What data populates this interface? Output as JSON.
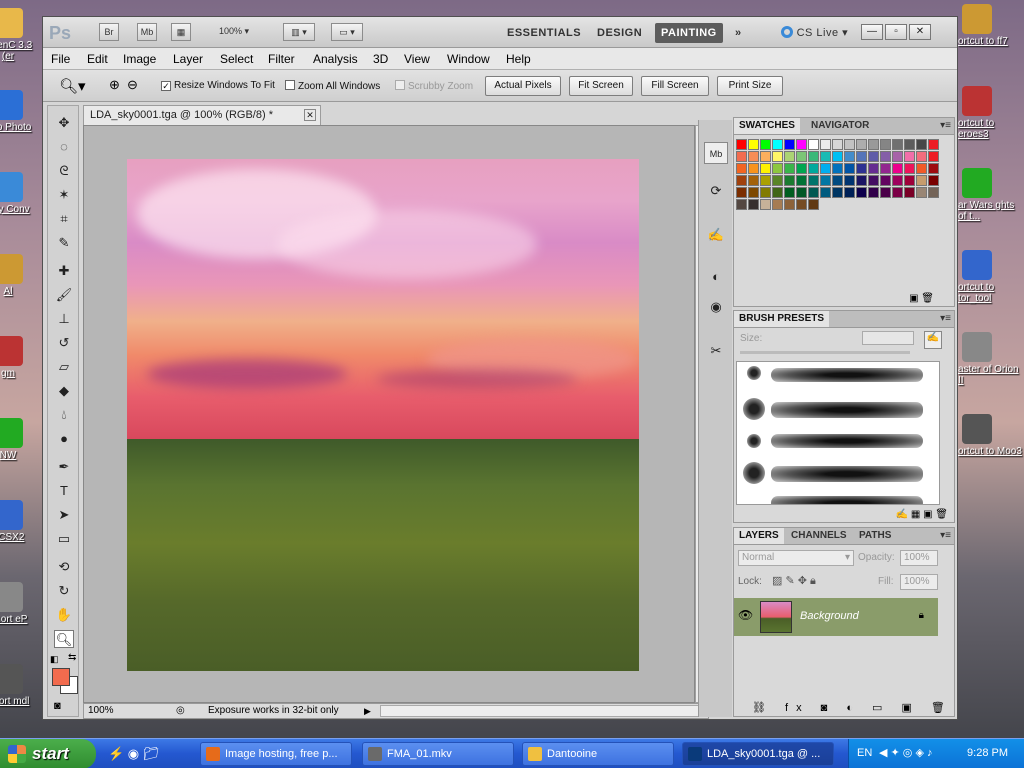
{
  "desktop": {
    "icons_left": [
      {
        "label": "OpenC 3.3 (er",
        "icon": "folder-icon"
      },
      {
        "label": "Ado Photo",
        "icon": "adobe-icon"
      },
      {
        "label": "Any Conv",
        "icon": "converter-icon"
      },
      {
        "label": "Al",
        "icon": "app-icon"
      },
      {
        "label": "gm",
        "icon": "gimp-icon"
      },
      {
        "label": "NW",
        "icon": "nwn-icon"
      },
      {
        "label": "PCSX2",
        "icon": "pcsx2-icon"
      },
      {
        "label": "Short eP",
        "icon": "shortcut-icon"
      },
      {
        "label": "Short mdl",
        "icon": "shortcut-icon"
      }
    ],
    "icons_right": [
      {
        "label": "ortcut to ff7",
        "icon": "ff7-icon"
      },
      {
        "label": "ortcut to eroes3",
        "icon": "heroes-icon"
      },
      {
        "label": "ar Wars ghts of t...",
        "icon": "starwars-icon"
      },
      {
        "label": "ortcut to tor_tool",
        "icon": "tool-icon"
      },
      {
        "label": "aster of Orion II",
        "icon": "orion-icon"
      },
      {
        "label": "ortcut to Moo3",
        "icon": "moo3-icon"
      }
    ]
  },
  "app": {
    "logo": "Ps",
    "bridge_btn": "Br",
    "minibridge_btn": "Mb",
    "zoom_level": "100%",
    "workspaces": [
      "ESSENTIALS",
      "DESIGN",
      "PAINTING"
    ],
    "active_workspace": "PAINTING",
    "more_label": "»",
    "cslive": "CS Live"
  },
  "menu": [
    "File",
    "Edit",
    "Image",
    "Layer",
    "Select",
    "Filter",
    "Analysis",
    "3D",
    "View",
    "Window",
    "Help"
  ],
  "options": {
    "resize_windows": "Resize Windows To Fit",
    "zoom_all": "Zoom All Windows",
    "scrubby": "Scrubby Zoom",
    "actual_pixels": "Actual Pixels",
    "fit_screen": "Fit Screen",
    "fill_screen": "Fill Screen",
    "print_size": "Print Size"
  },
  "document": {
    "tab_title": "LDA_sky0001.tga @ 100% (RGB/8) *",
    "zoom": "100%",
    "status": "Exposure works in 32-bit only"
  },
  "colors": {
    "foreground": "#f26b4e",
    "background": "#ffffff",
    "layer_highlight": "#8a9c6a"
  },
  "swatches": {
    "tabs": [
      "SWATCHES",
      "NAVIGATOR"
    ],
    "colors": [
      "#ff0000",
      "#ffff00",
      "#00ff00",
      "#00ffff",
      "#0000ff",
      "#ff00ff",
      "#ffffff",
      "#ebebeb",
      "#d6d6d6",
      "#c2c2c2",
      "#adadad",
      "#999999",
      "#858585",
      "#707070",
      "#5c5c5c",
      "#474747",
      "#ed1c24",
      "#f26c4f",
      "#f68e56",
      "#fbaf5d",
      "#fff568",
      "#acd373",
      "#7cc576",
      "#3bb878",
      "#1abbb4",
      "#00bff3",
      "#438ccb",
      "#5574b9",
      "#605ca8",
      "#855fa8",
      "#a763a8",
      "#f06ea9",
      "#f26d7d",
      "#ed1c24",
      "#f26522",
      "#f7941d",
      "#fff200",
      "#8dc63f",
      "#39b54a",
      "#00a651",
      "#00a99d",
      "#00aeef",
      "#0072bc",
      "#0054a6",
      "#2e3192",
      "#662d91",
      "#92278f",
      "#ec008c",
      "#ed145b",
      "#f05a28",
      "#9e0b0f",
      "#a0410d",
      "#a36209",
      "#aba000",
      "#598527",
      "#1a7b30",
      "#007236",
      "#00746b",
      "#0076a3",
      "#004a80",
      "#003471",
      "#1b1464",
      "#440e62",
      "#630460",
      "#9e005d",
      "#9e0039",
      "#c69c6d",
      "#790000",
      "#7b2e00",
      "#7d4900",
      "#827b00",
      "#406618",
      "#005e20",
      "#005826",
      "#005952",
      "#005b7f",
      "#003663",
      "#002157",
      "#0d004c",
      "#32004b",
      "#4b0049",
      "#7b0046",
      "#7a0026",
      "#998675",
      "#736357",
      "#534741",
      "#362f2d",
      "#c7b299",
      "#a67c52",
      "#8c6239",
      "#754c24",
      "#603913"
    ]
  },
  "brush_presets": {
    "tab": "BRUSH PRESETS",
    "size_label": "Size:"
  },
  "layers": {
    "tabs": [
      "LAYERS",
      "CHANNELS",
      "PATHS"
    ],
    "blend_mode": "Normal",
    "opacity_label": "Opacity:",
    "opacity": "100%",
    "lock_label": "Lock:",
    "fill_label": "Fill:",
    "fill": "100%",
    "layer_name": "Background"
  },
  "taskbar": {
    "start": "start",
    "windows": [
      {
        "label": "Image hosting, free p...",
        "icon": "firefox-icon",
        "active": false
      },
      {
        "label": "FMA_01.mkv",
        "icon": "media-icon",
        "active": false
      },
      {
        "label": "Dantooine",
        "icon": "folder-icon",
        "active": false
      },
      {
        "label": "LDA_sky0001.tga @ ...",
        "icon": "photoshop-icon",
        "active": true
      }
    ],
    "lang": "EN",
    "time": "9:28 PM"
  }
}
